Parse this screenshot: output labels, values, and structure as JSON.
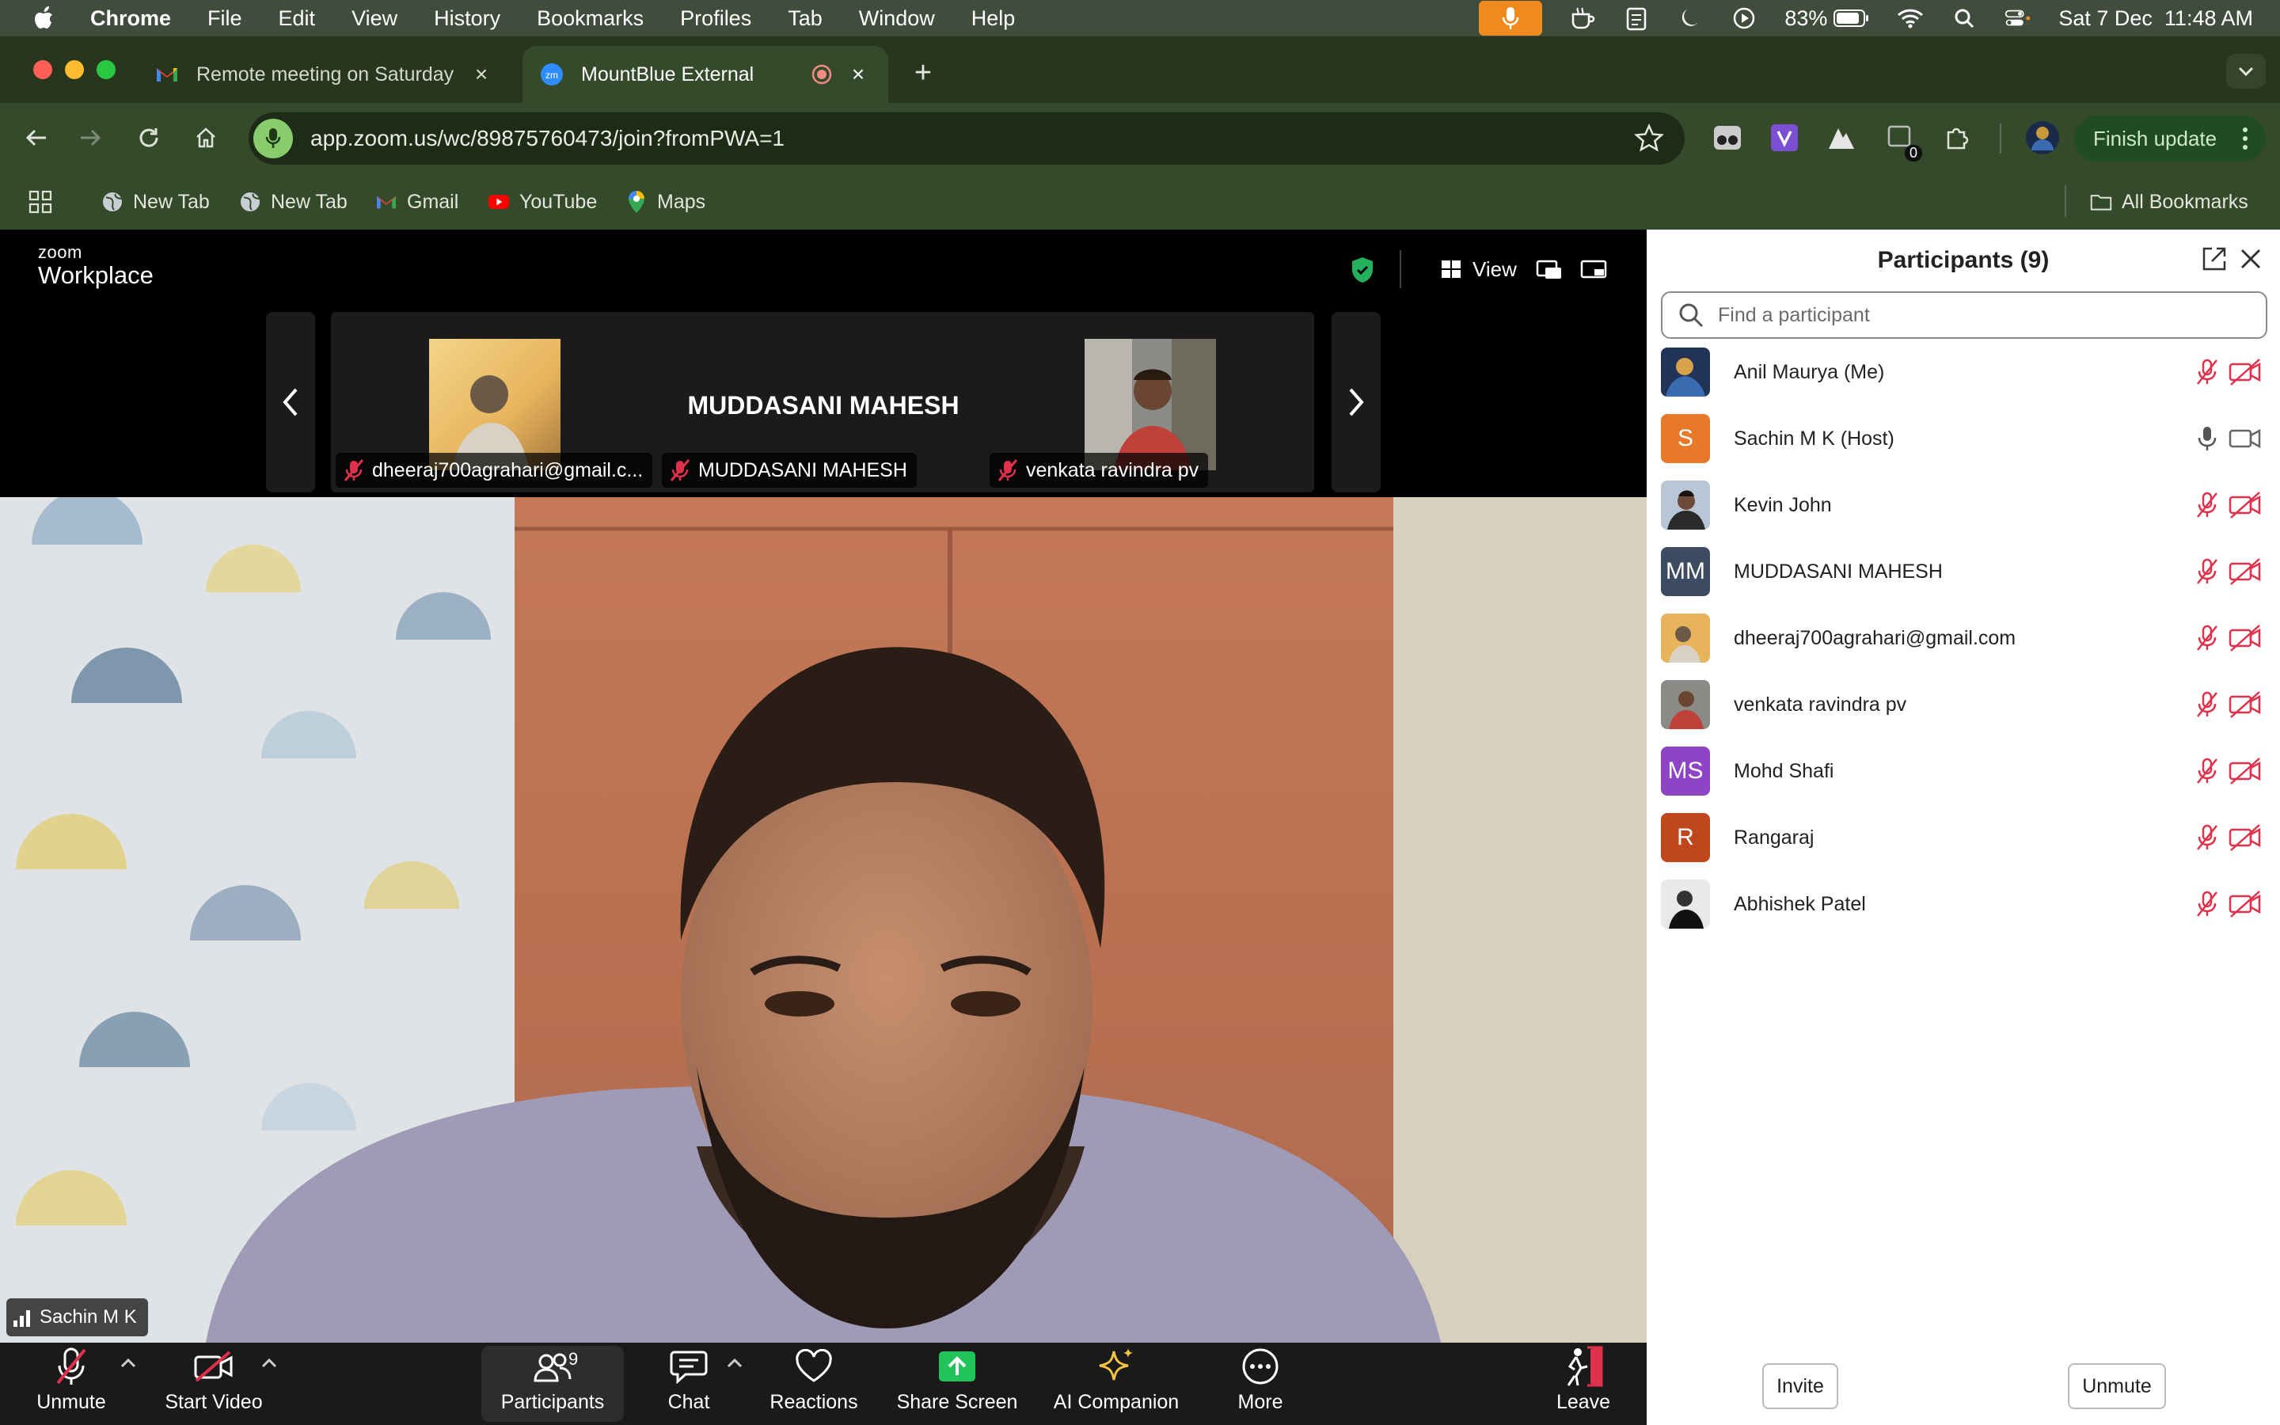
{
  "menubar": {
    "app_name": "Chrome",
    "items": [
      "File",
      "Edit",
      "View",
      "History",
      "Bookmarks",
      "Profiles",
      "Tab",
      "Window",
      "Help"
    ],
    "battery": "83%",
    "datetime": "Sat 7 Dec  11:48 AM"
  },
  "tabs": [
    {
      "title": "Remote meeting on Saturday",
      "icon": "gmail-icon"
    },
    {
      "title": "MountBlue External",
      "icon": "zoom-icon",
      "active": true
    }
  ],
  "address_bar": {
    "url": "app.zoom.us/wc/89875760473/join?fromPWA=1"
  },
  "extensions": {
    "badge_count": "0"
  },
  "finish_update_label": "Finish update",
  "bookmarks": [
    {
      "label": "New Tab",
      "icon": "globe-icon"
    },
    {
      "label": "New Tab",
      "icon": "globe-icon"
    },
    {
      "label": "Gmail",
      "icon": "gmail-icon"
    },
    {
      "label": "YouTube",
      "icon": "youtube-icon"
    },
    {
      "label": "Maps",
      "icon": "maps-icon"
    }
  ],
  "all_bookmarks_label": "All Bookmarks",
  "zoom": {
    "logo_small": "zoom",
    "logo_big": "Workplace",
    "view_label": "View",
    "gallery": {
      "center_name": "MUDDASANI MAHESH",
      "tiles": [
        {
          "label": "dheeraj700agrahari@gmail.c..."
        },
        {
          "label": "MUDDASANI MAHESH"
        },
        {
          "label": "venkata ravindra pv"
        }
      ]
    },
    "active_speaker": "Sachin M K",
    "footer": {
      "unmute": "Unmute",
      "start_video": "Start Video",
      "participants": "Participants",
      "participants_count": "9",
      "chat": "Chat",
      "reactions": "Reactions",
      "share_screen": "Share Screen",
      "ai_companion": "AI Companion",
      "more": "More",
      "leave": "Leave"
    }
  },
  "panel": {
    "title": "Participants (9)",
    "search_placeholder": "Find a participant",
    "participants": [
      {
        "name": "Anil Maurya (Me)",
        "avatar": "photo",
        "muted": true,
        "video_off": true
      },
      {
        "name": "Sachin M K (Host)",
        "avatar": "S",
        "avatar_color": "#e8782a",
        "muted": false,
        "video_off": false
      },
      {
        "name": "Kevin John",
        "avatar": "photo",
        "muted": true,
        "video_off": true
      },
      {
        "name": "MUDDASANI MAHESH",
        "avatar": "MM",
        "avatar_color": "#3d4b63",
        "muted": true,
        "video_off": true
      },
      {
        "name": "dheeraj700agrahari@gmail.com",
        "avatar": "photo",
        "muted": true,
        "video_off": true
      },
      {
        "name": "venkata ravindra pv",
        "avatar": "photo",
        "muted": true,
        "video_off": true
      },
      {
        "name": "Mohd Shafi",
        "avatar": "MS",
        "avatar_color": "#8e44c4",
        "muted": true,
        "video_off": true
      },
      {
        "name": "Rangaraj",
        "avatar": "R",
        "avatar_color": "#c0461d",
        "muted": true,
        "video_off": true
      },
      {
        "name": "Abhishek Patel",
        "avatar": "photo",
        "muted": true,
        "video_off": true
      }
    ],
    "invite_label": "Invite",
    "unmute_label": "Unmute"
  },
  "colors": {
    "muted_red": "#e0314c",
    "share_green": "#21c45a",
    "ai_yellow": "#f6c445"
  }
}
